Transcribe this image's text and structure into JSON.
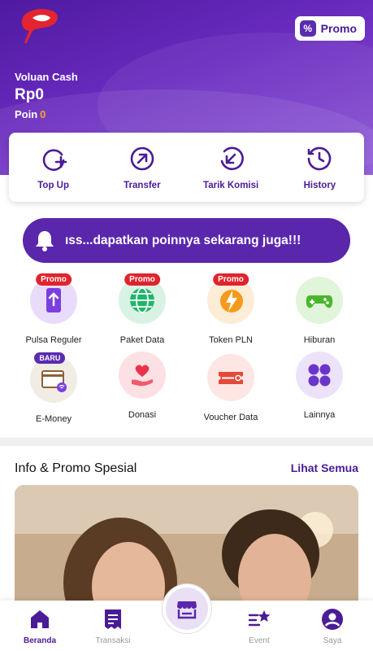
{
  "header": {
    "promo_label": "Promo",
    "wallet_name": "Voluan Cash",
    "balance": "Rp0",
    "poin_label": "Poin",
    "poin_value": "0"
  },
  "actions": [
    {
      "label": "Top Up",
      "icon": "plus-circle-icon"
    },
    {
      "label": "Transfer",
      "icon": "arrow-up-right-icon"
    },
    {
      "label": "Tarik Komisi",
      "icon": "arrow-down-left-icon"
    },
    {
      "label": "History",
      "icon": "clock-icon"
    }
  ],
  "marquee": {
    "text": "ıss...dapatkan poinnya sekarang juga!!!"
  },
  "services": [
    {
      "label": "Pulsa Reguler",
      "badge": "Promo",
      "icon": "phone-icon"
    },
    {
      "label": "Paket Data",
      "badge": "Promo",
      "icon": "globe-icon"
    },
    {
      "label": "Token PLN",
      "badge": "Promo",
      "icon": "lightning-icon"
    },
    {
      "label": "Hiburan",
      "badge": "",
      "icon": "gamepad-icon"
    },
    {
      "label": "E-Money",
      "badge": "BARU",
      "icon": "card-icon"
    },
    {
      "label": "Donasi",
      "badge": "",
      "icon": "heart-hand-icon"
    },
    {
      "label": "Voucher Data",
      "badge": "",
      "icon": "voucher-icon"
    },
    {
      "label": "Lainnya",
      "badge": "",
      "icon": "grid-icon"
    }
  ],
  "info": {
    "title": "Info & Promo Spesial",
    "see_all": "Lihat Semua"
  },
  "nav": [
    {
      "label": "Beranda",
      "active": true
    },
    {
      "label": "Transaksi",
      "active": false
    },
    {
      "label": "Event",
      "active": false
    },
    {
      "label": "Saya",
      "active": false
    }
  ],
  "colors": {
    "primary": "#4a1c96",
    "badge": "#e0242d",
    "accent": "#f5a623"
  }
}
